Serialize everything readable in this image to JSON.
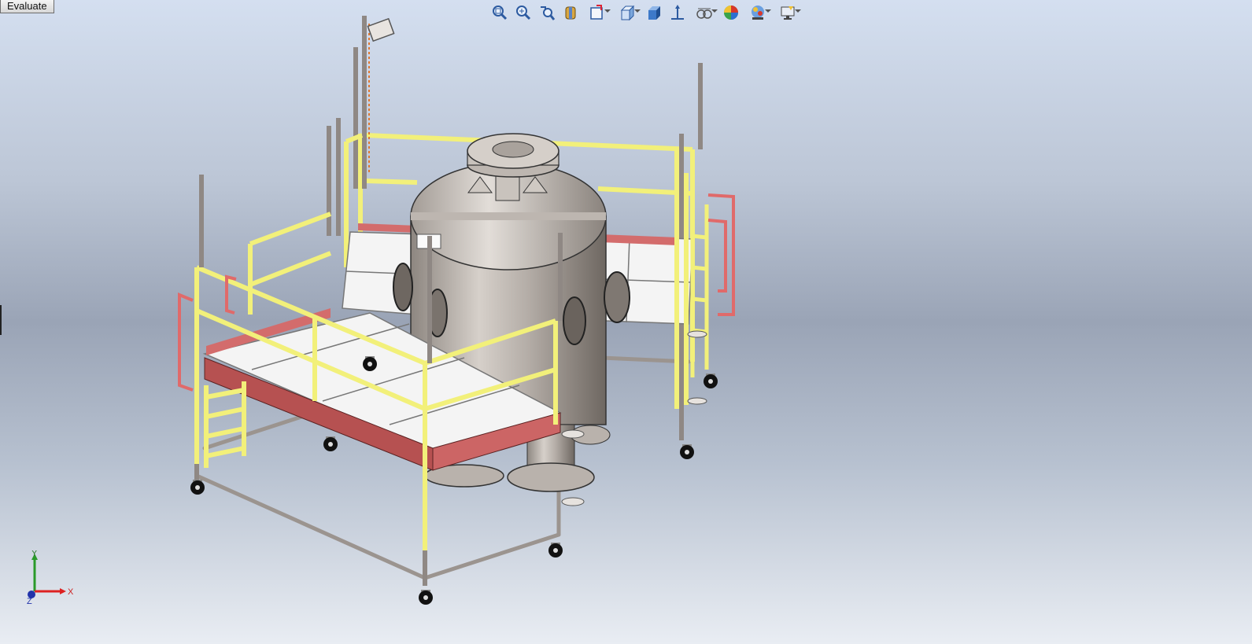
{
  "tabs": {
    "evaluate_label": "Evaluate"
  },
  "heads_up_toolbar": {
    "buttons": [
      {
        "name": "zoom-to-fit-icon"
      },
      {
        "name": "zoom-to-area-icon"
      },
      {
        "name": "previous-view-icon"
      },
      {
        "name": "section-view-icon"
      },
      {
        "name": "dynamic-annotation-views-icon",
        "dropdown": true
      },
      {
        "name": "view-orientation-icon",
        "dropdown": true
      },
      {
        "name": "display-style-icon"
      },
      {
        "name": "hide-show-items-icon"
      },
      {
        "name": "edit-appearance-icon",
        "dropdown": true
      },
      {
        "name": "apply-scene-icon"
      },
      {
        "name": "view-settings-icon",
        "dropdown": true
      },
      {
        "name": "display-pane-icon",
        "dropdown": true
      }
    ]
  },
  "colors": {
    "railing_yellow": "#f2f07a",
    "toe_board_red": "#c86060",
    "frame_gray": "#a9a29d",
    "vessel_gray": "#b2aba5",
    "background_top": "#d4dff0",
    "background_mid": "#9aa4b6"
  },
  "triad": {
    "x_label": "X",
    "y_label": "Y",
    "z_label": "Z"
  }
}
